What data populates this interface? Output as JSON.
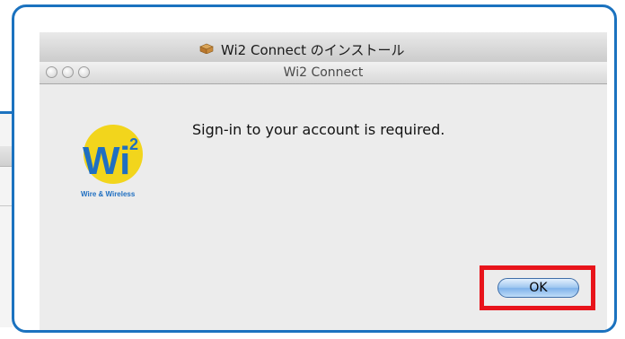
{
  "installer": {
    "title": "Wi2 Connect のインストール",
    "icon": "package-icon"
  },
  "dialog": {
    "title": "Wi2 Connect",
    "message": "Sign-in to your account is required.",
    "ok_label": "OK",
    "window_buttons": [
      "close-icon",
      "minimize-icon",
      "zoom-icon"
    ]
  },
  "logo": {
    "mark": "Wi",
    "superscript": "2",
    "tagline": "Wire & Wireless"
  },
  "colors": {
    "callout_border": "#1b72bf",
    "highlight": "#e8141b",
    "logo_blue": "#1f6fc1",
    "logo_yellow": "#f2d51c"
  }
}
